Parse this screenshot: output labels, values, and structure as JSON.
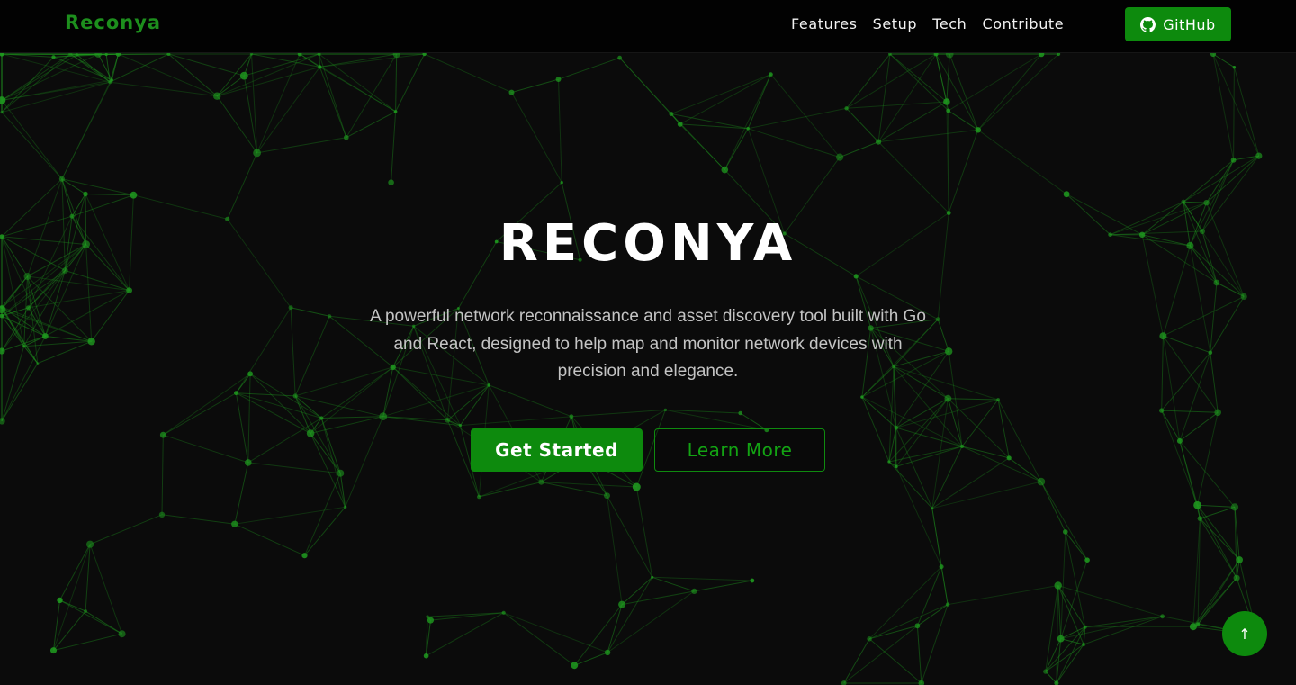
{
  "nav": {
    "brand": "Reconya",
    "links": [
      "Features",
      "Setup",
      "Tech",
      "Contribute"
    ],
    "github_label": "GitHub",
    "github_icon": "github-icon"
  },
  "hero": {
    "title": "RECONYA",
    "subtitle_lines": [
      "A powerful network reconnaissance and asset discovery tool built with Go",
      "and React, designed to help map and monitor network devices with",
      "precision and elegance."
    ],
    "primary_button": "Get Started",
    "secondary_button": "Learn More"
  },
  "scroll_top": {
    "icon": "arrow-up-icon",
    "glyph": "↑"
  },
  "colors": {
    "accent": "#0d8a0d",
    "accent_text": "#1d8f1d",
    "background": "#0b0b0b",
    "network_line": "#1f9a1f"
  }
}
